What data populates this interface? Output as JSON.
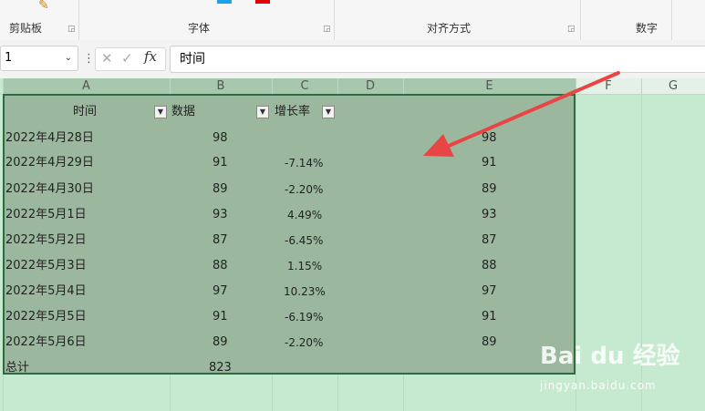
{
  "ribbon": {
    "groups": [
      "剪贴板",
      "字体",
      "对齐方式",
      "数字"
    ],
    "accent_colors": [
      "#1aa3e8",
      "#e00000"
    ]
  },
  "formula_bar": {
    "name_box": "1",
    "fx": "fx",
    "value": "时间"
  },
  "columns": [
    "A",
    "B",
    "C",
    "D",
    "E",
    "F",
    "G"
  ],
  "table": {
    "headers": [
      "时间",
      "数据",
      "增长率"
    ],
    "rows": [
      {
        "date": "2022年4月28日",
        "value": "98",
        "rate": "",
        "e": "98"
      },
      {
        "date": "2022年4月29日",
        "value": "91",
        "rate": "-7.14%",
        "e": "91"
      },
      {
        "date": "2022年4月30日",
        "value": "89",
        "rate": "-2.20%",
        "e": "89"
      },
      {
        "date": "2022年5月1日",
        "value": "93",
        "rate": "4.49%",
        "e": "93"
      },
      {
        "date": "2022年5月2日",
        "value": "87",
        "rate": "-6.45%",
        "e": "87"
      },
      {
        "date": "2022年5月3日",
        "value": "88",
        "rate": "1.15%",
        "e": "88"
      },
      {
        "date": "2022年5月4日",
        "value": "97",
        "rate": "10.23%",
        "e": "97"
      },
      {
        "date": "2022年5月5日",
        "value": "91",
        "rate": "-6.19%",
        "e": "91"
      },
      {
        "date": "2022年5月6日",
        "value": "89",
        "rate": "-2.20%",
        "e": "89"
      }
    ],
    "total_label": "总计",
    "total_value": "823"
  },
  "watermark": {
    "logo": "Bai du 经验",
    "url": "jingyan.baidu.com"
  },
  "colors": {
    "selection": "#9bb89f",
    "sheet": "#c6ead0",
    "arrow": "#e84545"
  }
}
